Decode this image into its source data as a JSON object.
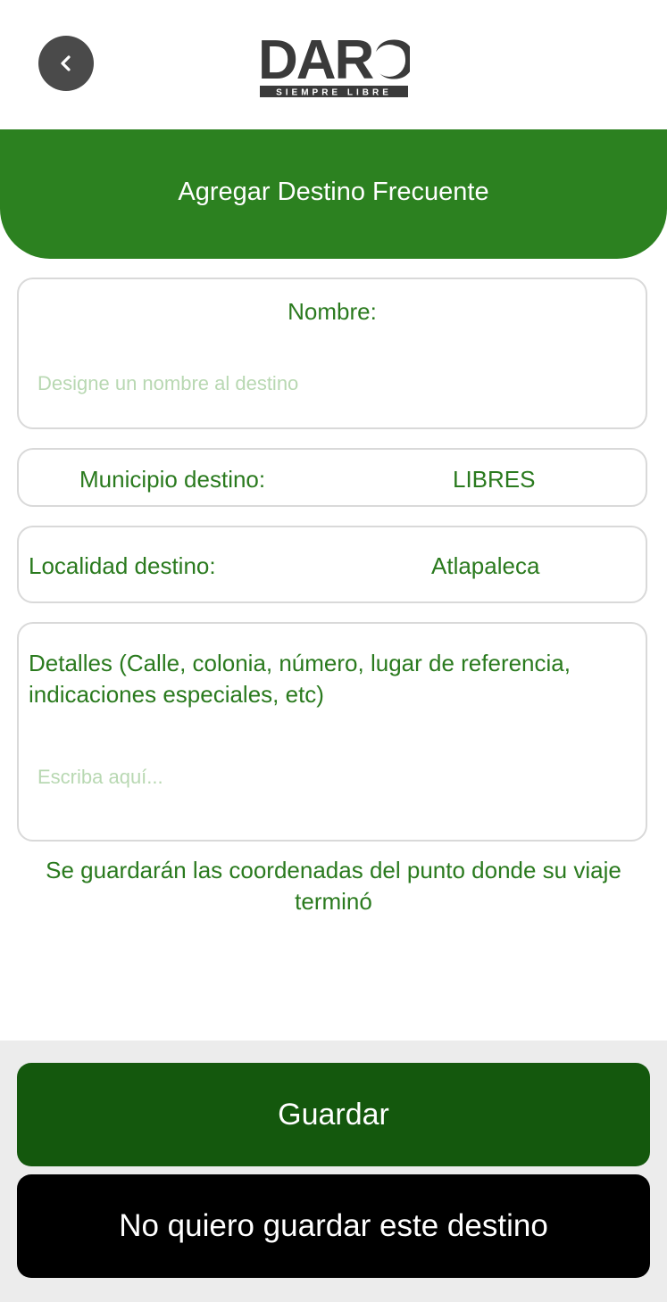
{
  "header": {
    "logo_text": "DARO",
    "logo_tagline": "SIEMPRE LIBRE"
  },
  "banner": {
    "title": "Agregar Destino Frecuente"
  },
  "form": {
    "nombre": {
      "label": "Nombre:",
      "placeholder": "Designe un nombre al destino"
    },
    "municipio": {
      "label": "Municipio destino:",
      "value": "LIBRES"
    },
    "localidad": {
      "label": "Localidad destino:",
      "value": "Atlapaleca"
    },
    "detalles": {
      "label": "Detalles (Calle, colonia, número, lugar de referencia, indicaciones especiales, etc)",
      "placeholder": "Escriba aquí..."
    }
  },
  "note": "Se guardarán las coordenadas del punto donde su viaje terminó",
  "buttons": {
    "save": "Guardar",
    "cancel": "No quiero guardar este destino"
  },
  "colors": {
    "primary_green": "#2c8120",
    "dark_green": "#14580d",
    "text_green": "#2a7a1e",
    "placeholder_green": "#b8d8b2"
  },
  "icons": {
    "back": "chevron-left-icon",
    "logo_pin": "map-pin-icon"
  }
}
